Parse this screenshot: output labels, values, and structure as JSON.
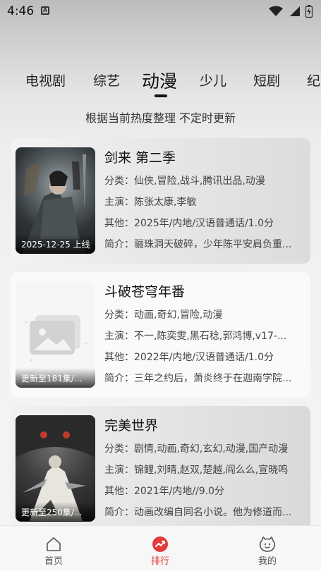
{
  "status_bar": {
    "time": "4:46",
    "notif_letter": "A"
  },
  "tabs": [
    {
      "label": "电视剧"
    },
    {
      "label": "综艺"
    },
    {
      "label": "动漫"
    },
    {
      "label": "少儿"
    },
    {
      "label": "短剧"
    },
    {
      "label": "纪"
    }
  ],
  "subtitle": "根据当前热度整理 不定时更新",
  "cards": [
    {
      "title": "剑来 第二季",
      "poster_caption": "2025-12-25 上线",
      "category": "分类：仙侠,冒险,战斗,腾讯出品,动漫",
      "cast": "主演：陈张太康,李敏",
      "other": "其他：2025年/内地/汉语普通话/1.0分",
      "summary": "简介：骊珠洞天破碎，少年陈平安肩负重..."
    },
    {
      "title": "斗破苍穹年番",
      "poster_caption": "更新至181集/...",
      "category": "分类：动画,奇幻,冒险,动漫",
      "cast": "主演：不一,陈奕雯,黑石稔,郭鸿博,v17-...",
      "other": "其他：2022年/内地/汉语普通话/1.0分",
      "summary": "简介：三年之约后，萧炎终于在迦南学院..."
    },
    {
      "title": "完美世界",
      "poster_caption": "更新至250集/...",
      "category": "分类：剧情,动画,奇幻,玄幻,动漫,国产动漫",
      "cast": "主演：锦鲤,刘晴,赵双,楚越,阎么么,宣晓鸣",
      "other": "其他：2021年/内地//9.0分",
      "summary": "简介：动画改编自同名小说。他为修道而..."
    }
  ],
  "bottom_nav": [
    {
      "label": "首页",
      "icon": "home-icon"
    },
    {
      "label": "排行",
      "icon": "trending-icon",
      "active": true
    },
    {
      "label": "我的",
      "icon": "smiley-icon"
    }
  ],
  "colors": {
    "accent": "#e23b3b"
  }
}
